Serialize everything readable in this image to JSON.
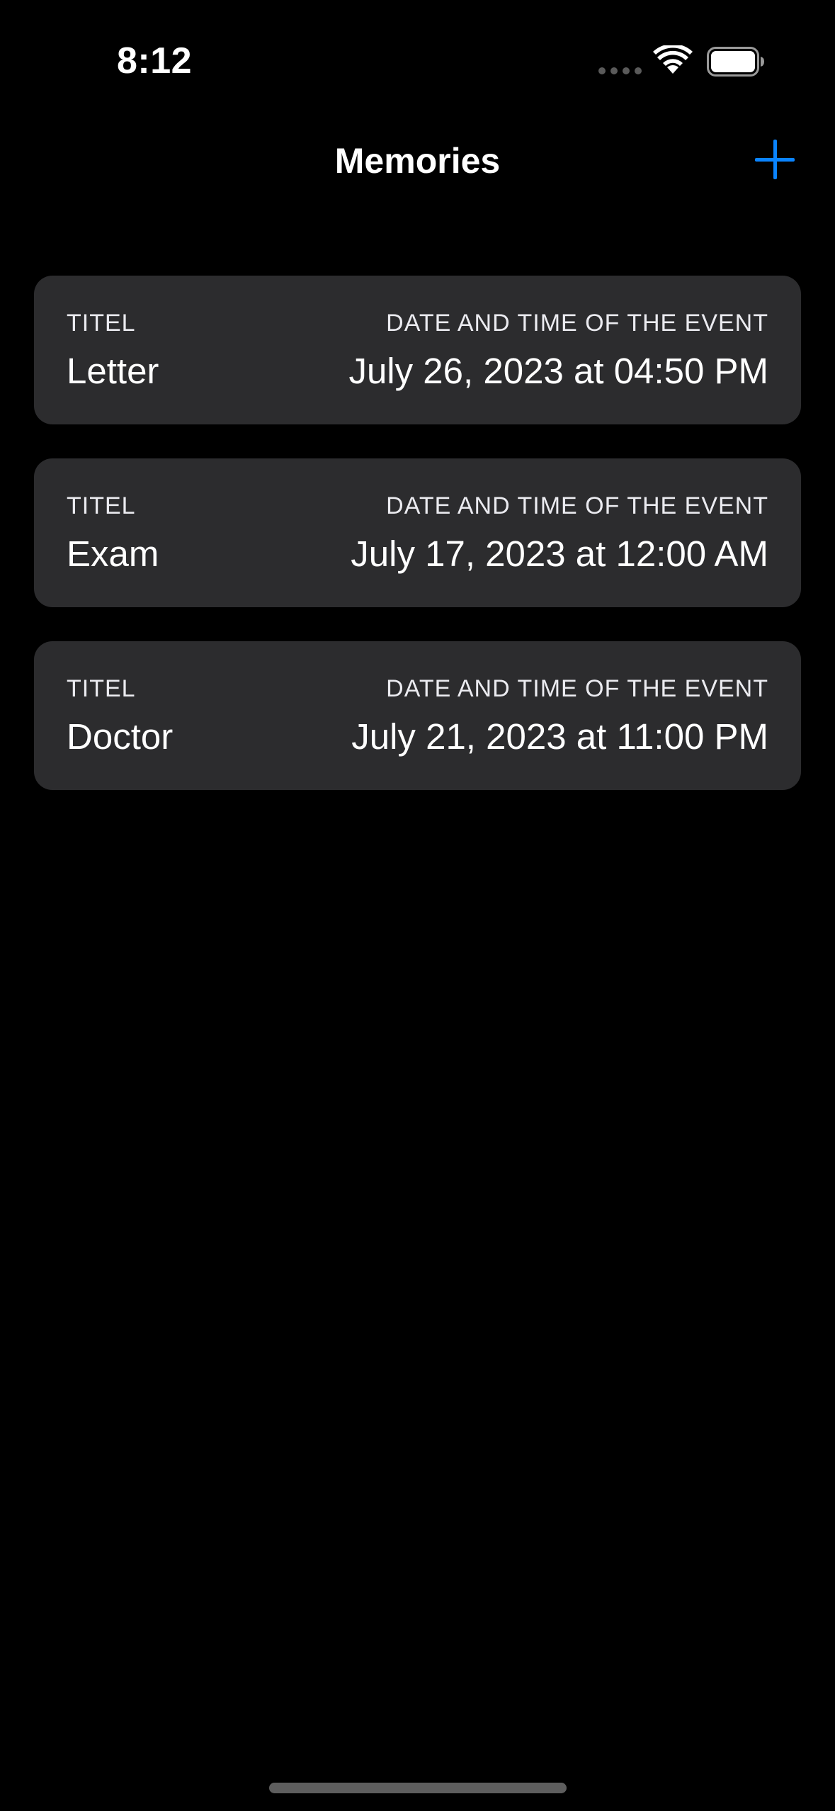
{
  "status_bar": {
    "time": "8:12"
  },
  "nav": {
    "title": "Memories",
    "add_icon": "plus-icon",
    "accent_color": "#0a84ff"
  },
  "memories": [
    {
      "title_label": "TITEL",
      "title": "Letter",
      "date_label": "DATE AND TIME OF THE EVENT",
      "date": "July 26, 2023 at 04:50 PM"
    },
    {
      "title_label": "TITEL",
      "title": "Exam",
      "date_label": "DATE AND TIME OF THE EVENT",
      "date": "July 17, 2023 at 12:00 AM"
    },
    {
      "title_label": "TITEL",
      "title": "Doctor",
      "date_label": "DATE AND TIME OF THE EVENT",
      "date": "July 21, 2023 at 11:00 PM"
    }
  ]
}
